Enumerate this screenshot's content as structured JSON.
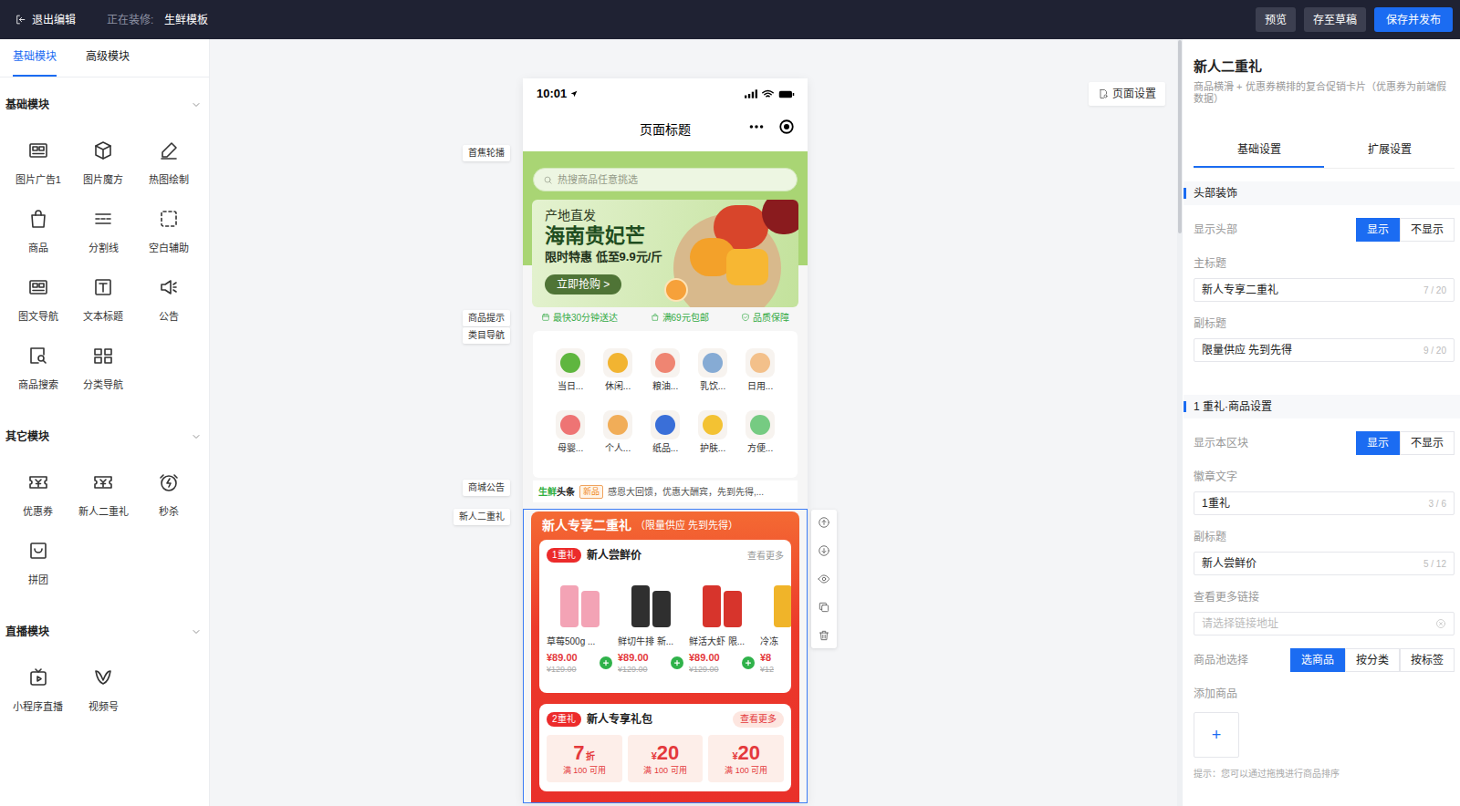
{
  "topbar": {
    "exit": "退出编辑",
    "editing_label": "正在装修:",
    "template": "生鲜模板",
    "buttons": [
      {
        "label": "预览",
        "primary": false
      },
      {
        "label": "存至草稿",
        "primary": false
      },
      {
        "label": "保存并发布",
        "primary": true
      }
    ]
  },
  "left_panel": {
    "tabs": [
      {
        "label": "基础模块",
        "selected": true
      },
      {
        "label": "高级模块",
        "selected": false
      }
    ],
    "groups": [
      {
        "title": "基础模块",
        "expanded": true,
        "items": [
          "图片广告1",
          "图片魔方",
          "热图绘制",
          "商品",
          "分割线",
          "空白辅助",
          "图文导航",
          "文本标题",
          "公告",
          "商品搜索",
          "分类导航"
        ]
      },
      {
        "title": "其它模块",
        "expanded": true,
        "items": [
          "优惠券",
          "新人二重礼",
          "秒杀",
          "拼团"
        ]
      },
      {
        "title": "直播模块",
        "expanded": true,
        "items": [
          "小程序直播",
          "视频号"
        ]
      }
    ]
  },
  "canvas": {
    "page_settings": "页面设置",
    "module_labels": [
      "首焦轮播",
      "商品提示",
      "类目导航",
      "商城公告",
      "新人二重礼"
    ]
  },
  "preview": {
    "status_time": "10:01",
    "title": "页面标题",
    "search_placeholder": "热搜商品任意挑选",
    "banner": {
      "kicker": "产地直发",
      "title": "海南贵妃芒",
      "subtitle": "限时特惠 低至9.9元/斤",
      "button": "立即抢购 >"
    },
    "tips": [
      "最快30分钟送达",
      "满69元包邮",
      "品质保障"
    ],
    "categories": [
      {
        "label": "当日...",
        "color": "#5fb63f"
      },
      {
        "label": "休闲...",
        "color": "#f2b431"
      },
      {
        "label": "粮油...",
        "color": "#ef8572"
      },
      {
        "label": "乳饮...",
        "color": "#86abd4"
      },
      {
        "label": "日用...",
        "color": "#f3c08a"
      },
      {
        "label": "母婴...",
        "color": "#ee7474"
      },
      {
        "label": "个人...",
        "color": "#f1ad58"
      },
      {
        "label": "纸品...",
        "color": "#3a6fd8"
      },
      {
        "label": "护肤...",
        "color": "#f3c233"
      },
      {
        "label": "方便...",
        "color": "#76cb82"
      }
    ],
    "notice": {
      "brand_green": "生鲜",
      "brand_dark": "头条",
      "tag": "新品",
      "text": "感恩大回馈，优惠大酬宾，先到先得,..."
    },
    "gift": {
      "title": "新人专享二重礼",
      "subtitle": "（限量供应 先到先得）",
      "selected": true,
      "tier1": {
        "badge": "1重礼",
        "title": "新人尝鲜价",
        "more": "查看更多",
        "products": [
          {
            "name": "草莓500g ...",
            "price": "¥89.00",
            "original": "¥129.00",
            "color": "#f3a3b5"
          },
          {
            "name": "鲜切牛排 新...",
            "price": "¥89.00",
            "original": "¥129.00",
            "color": "#2f2f2f"
          },
          {
            "name": "鲜活大虾 限...",
            "price": "¥89.00",
            "original": "¥129.00",
            "color": "#d7342c"
          },
          {
            "name": "冷冻",
            "price": "¥8",
            "original": "¥12",
            "color": "#f0b429"
          }
        ]
      },
      "tier2": {
        "badge": "2重礼",
        "title": "新人专享礼包",
        "more": "查看更多",
        "coupons": [
          {
            "value": "7",
            "unit": "折",
            "condition": "满 100 可用"
          },
          {
            "prefix": "¥",
            "value": "20",
            "condition": "满 100 可用"
          },
          {
            "prefix": "¥",
            "value": "20",
            "condition": "满 100 可用"
          }
        ]
      }
    }
  },
  "settings": {
    "title": "新人二重礼",
    "description": "商品横滑 + 优惠券横排的复合促销卡片（优惠券为前端假数据）",
    "tabs": [
      {
        "label": "基础设置",
        "selected": true
      },
      {
        "label": "扩展设置",
        "selected": false
      }
    ],
    "sections": [
      {
        "title": "头部装饰",
        "fields": [
          {
            "kind": "segmented",
            "label": "显示头部",
            "options": [
              {
                "label": "显示",
                "selected": true
              },
              {
                "label": "不显示",
                "selected": false
              }
            ]
          },
          {
            "kind": "text",
            "label": "主标题",
            "value": "新人专享二重礼",
            "count": "7 / 20"
          },
          {
            "kind": "text",
            "label": "副标题",
            "value": "限量供应 先到先得",
            "count": "9 / 20"
          }
        ]
      },
      {
        "title": "1 重礼·商品设置",
        "fields": [
          {
            "kind": "segmented",
            "label": "显示本区块",
            "options": [
              {
                "label": "显示",
                "selected": true
              },
              {
                "label": "不显示",
                "selected": false
              }
            ]
          },
          {
            "kind": "text",
            "label": "徽章文字",
            "value": "1重礼",
            "count": "3 / 6"
          },
          {
            "kind": "text",
            "label": "副标题",
            "value": "新人尝鲜价",
            "count": "5 / 12"
          },
          {
            "kind": "link",
            "label": "查看更多链接",
            "placeholder": "请选择链接地址"
          },
          {
            "kind": "segmented",
            "label": "商品池选择",
            "options": [
              {
                "label": "选商品",
                "selected": true
              },
              {
                "label": "按分类",
                "selected": false
              },
              {
                "label": "按标签",
                "selected": false
              }
            ]
          },
          {
            "kind": "add",
            "label": "添加商品",
            "button": "+",
            "hint": "提示：您可以通过拖拽进行商品排序"
          }
        ]
      }
    ]
  }
}
